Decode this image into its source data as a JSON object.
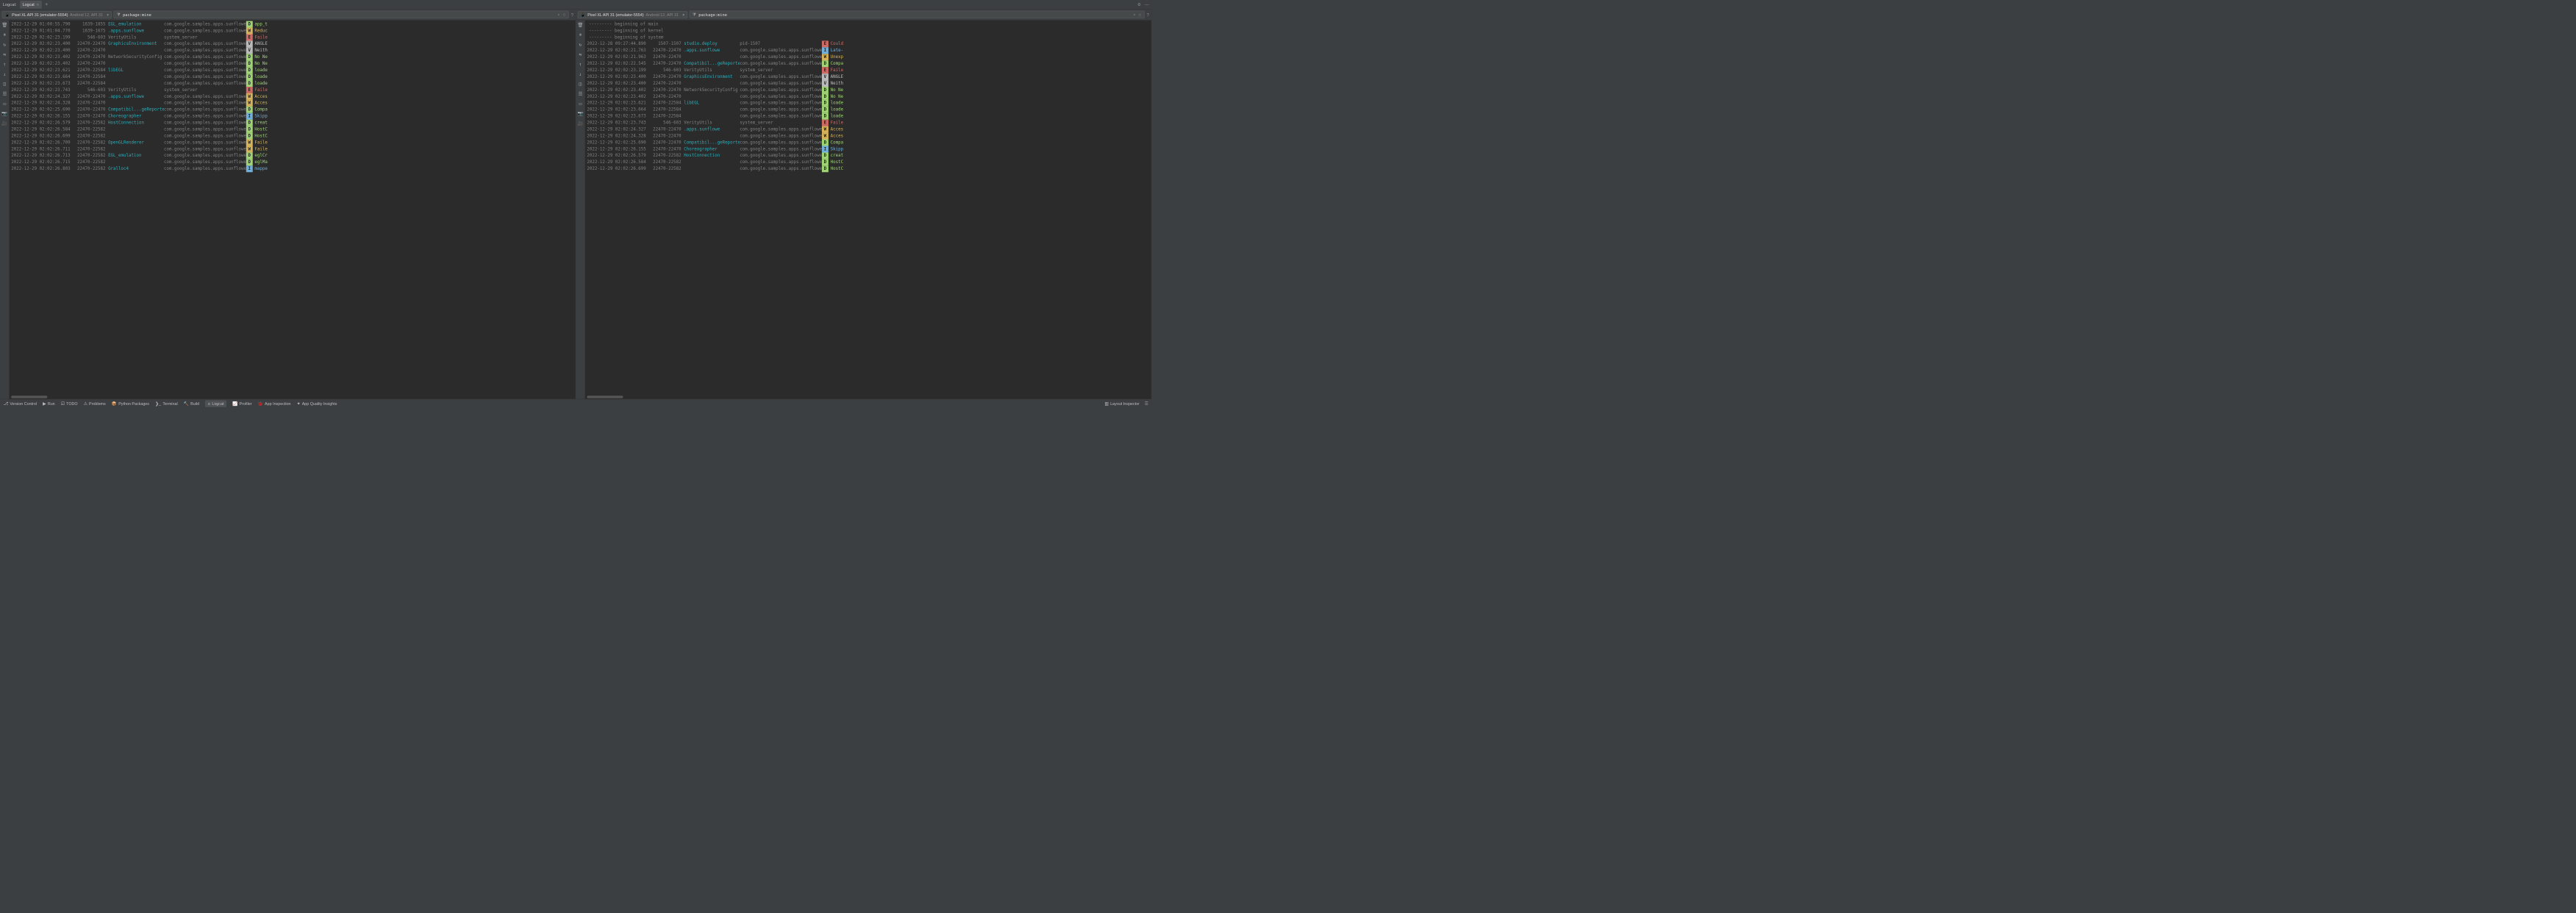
{
  "topbar": {
    "title": "Logcat:",
    "tab": "Logcat"
  },
  "device": {
    "name": "Pixel XL API 31 (emulator-5554)",
    "api": "Android 12, API 31"
  },
  "filter": {
    "text": "package:mine"
  },
  "left_logs": [
    {
      "ts": "2022-12-29 01:00:55.790",
      "pt": "1639-1855",
      "tag": "EGL_emulation",
      "tagc": "cyan",
      "pkg": "com.google.samples.apps.sunflower",
      "lvl": "D",
      "msg": "app_t"
    },
    {
      "ts": "2022-12-29 01:01:04.770",
      "pt": "1639-1675",
      "tag": ".apps.sunflowe",
      "tagc": "cyan",
      "pkg": "com.google.samples.apps.sunflower",
      "lvl": "W",
      "msg": "Reduc"
    },
    {
      "ts": "2022-12-29 02:02:23.199",
      "pt": "546-603",
      "tag": "VerityUtils",
      "tagc": "gray",
      "pkg": "system_server",
      "lvl": "E",
      "msg": "Faile"
    },
    {
      "ts": "2022-12-29 02:02:23.400",
      "pt": "22470-22470",
      "tag": "GraphicsEnvironment",
      "tagc": "cyan",
      "pkg": "com.google.samples.apps.sunflower",
      "lvl": "V",
      "msg": "ANGLE"
    },
    {
      "ts": "2022-12-29 02:02:23.400",
      "pt": "22470-22470",
      "tag": "",
      "tagc": "gray",
      "pkg": "com.google.samples.apps.sunflower",
      "lvl": "V",
      "msg": "Neith"
    },
    {
      "ts": "2022-12-29 02:02:23.402",
      "pt": "22470-22470",
      "tag": "NetworkSecurityConfig",
      "tagc": "gray",
      "pkg": "com.google.samples.apps.sunflower",
      "lvl": "D",
      "msg": "No Ne"
    },
    {
      "ts": "2022-12-29 02:02:23.402",
      "pt": "22470-22470",
      "tag": "",
      "tagc": "gray",
      "pkg": "com.google.samples.apps.sunflower",
      "lvl": "D",
      "msg": "No Ne"
    },
    {
      "ts": "2022-12-29 02:02:23.621",
      "pt": "22470-22584",
      "tag": "libEGL",
      "tagc": "cyan",
      "pkg": "com.google.samples.apps.sunflower",
      "lvl": "D",
      "msg": "loade"
    },
    {
      "ts": "2022-12-29 02:02:23.664",
      "pt": "22470-22584",
      "tag": "",
      "tagc": "gray",
      "pkg": "com.google.samples.apps.sunflower",
      "lvl": "D",
      "msg": "loade"
    },
    {
      "ts": "2022-12-29 02:02:23.673",
      "pt": "22470-22584",
      "tag": "",
      "tagc": "gray",
      "pkg": "com.google.samples.apps.sunflower",
      "lvl": "D",
      "msg": "loade"
    },
    {
      "ts": "2022-12-29 02:02:23.743",
      "pt": "546-603",
      "tag": "VerityUtils",
      "tagc": "gray",
      "pkg": "system_server",
      "lvl": "E",
      "msg": "Faile"
    },
    {
      "ts": "2022-12-29 02:02:24.327",
      "pt": "22470-22470",
      "tag": ".apps.sunflowe",
      "tagc": "cyan",
      "pkg": "com.google.samples.apps.sunflower",
      "lvl": "W",
      "msg": "Acces"
    },
    {
      "ts": "2022-12-29 02:02:24.328",
      "pt": "22470-22470",
      "tag": "",
      "tagc": "gray",
      "pkg": "com.google.samples.apps.sunflower",
      "lvl": "W",
      "msg": "Acces"
    },
    {
      "ts": "2022-12-29 02:02:25.690",
      "pt": "22470-22470",
      "tag": "Compatibil...geReporter",
      "tagc": "cyan",
      "pkg": "com.google.samples.apps.sunflower",
      "lvl": "D",
      "msg": "Compa"
    },
    {
      "ts": "2022-12-29 02:02:26.155",
      "pt": "22470-22470",
      "tag": "Choreographer",
      "tagc": "cyan",
      "pkg": "com.google.samples.apps.sunflower",
      "lvl": "I",
      "msg": "Skipp"
    },
    {
      "ts": "2022-12-29 02:02:26.579",
      "pt": "22470-22582",
      "tag": "HostConnection",
      "tagc": "cyan",
      "pkg": "com.google.samples.apps.sunflower",
      "lvl": "D",
      "msg": "creat"
    },
    {
      "ts": "2022-12-29 02:02:26.584",
      "pt": "22470-22582",
      "tag": "",
      "tagc": "gray",
      "pkg": "com.google.samples.apps.sunflower",
      "lvl": "D",
      "msg": "HostC"
    },
    {
      "ts": "2022-12-29 02:02:26.699",
      "pt": "22470-22582",
      "tag": "",
      "tagc": "gray",
      "pkg": "com.google.samples.apps.sunflower",
      "lvl": "D",
      "msg": "HostC"
    },
    {
      "ts": "2022-12-29 02:02:26.709",
      "pt": "22470-22582",
      "tag": "OpenGLRenderer",
      "tagc": "cyan",
      "pkg": "com.google.samples.apps.sunflower",
      "lvl": "W",
      "msg": "Faile"
    },
    {
      "ts": "2022-12-29 02:02:26.711",
      "pt": "22470-22582",
      "tag": "",
      "tagc": "gray",
      "pkg": "com.google.samples.apps.sunflower",
      "lvl": "W",
      "msg": "Faile"
    },
    {
      "ts": "2022-12-29 02:02:26.713",
      "pt": "22470-22582",
      "tag": "EGL_emulation",
      "tagc": "cyan",
      "pkg": "com.google.samples.apps.sunflower",
      "lvl": "D",
      "msg": "eglCr"
    },
    {
      "ts": "2022-12-29 02:02:26.715",
      "pt": "22470-22582",
      "tag": "",
      "tagc": "gray",
      "pkg": "com.google.samples.apps.sunflower",
      "lvl": "D",
      "msg": "eglMa"
    },
    {
      "ts": "2022-12-29 02:02:26.803",
      "pt": "22470-22582",
      "tag": "Gralloc4",
      "tagc": "cyan",
      "pkg": "com.google.samples.apps.sunflower",
      "lvl": "I",
      "msg": "mappe"
    }
  ],
  "right_prelude": [
    "--------- beginning of main",
    "--------- beginning of kernel",
    "--------- beginning of system"
  ],
  "right_logs": [
    {
      "ts": "2022-12-28 09:27:44.890",
      "pt": "1507-1507",
      "tag": "studio.deploy",
      "tagc": "cyan",
      "pkg": "pid-1507",
      "lvl": "E",
      "msg": "Could"
    },
    {
      "ts": "2022-12-29 02:02:21.763",
      "pt": "22470-22470",
      "tag": ".apps.sunflowe",
      "tagc": "cyan",
      "pkg": "com.google.samples.apps.sunflower",
      "lvl": "I",
      "msg": "Late-"
    },
    {
      "ts": "2022-12-29 02:02:21.963",
      "pt": "22470-22470",
      "tag": "",
      "tagc": "gray",
      "pkg": "com.google.samples.apps.sunflower",
      "lvl": "W",
      "msg": "Unexp"
    },
    {
      "ts": "2022-12-29 02:02:22.545",
      "pt": "22470-22470",
      "tag": "Compatibil...geReporter",
      "tagc": "cyan",
      "pkg": "com.google.samples.apps.sunflower",
      "lvl": "D",
      "msg": "Compa"
    },
    {
      "ts": "2022-12-29 02:02:23.199",
      "pt": "546-603",
      "tag": "VerityUtils",
      "tagc": "gray",
      "pkg": "system_server",
      "lvl": "E",
      "msg": "Faile"
    },
    {
      "ts": "2022-12-29 02:02:23.400",
      "pt": "22470-22470",
      "tag": "GraphicsEnvironment",
      "tagc": "cyan",
      "pkg": "com.google.samples.apps.sunflower",
      "lvl": "V",
      "msg": "ANGLE"
    },
    {
      "ts": "2022-12-29 02:02:23.400",
      "pt": "22470-22470",
      "tag": "",
      "tagc": "gray",
      "pkg": "com.google.samples.apps.sunflower",
      "lvl": "V",
      "msg": "Neith"
    },
    {
      "ts": "2022-12-29 02:02:23.402",
      "pt": "22470-22470",
      "tag": "NetworkSecurityConfig",
      "tagc": "gray",
      "pkg": "com.google.samples.apps.sunflower",
      "lvl": "D",
      "msg": "No Ne"
    },
    {
      "ts": "2022-12-29 02:02:23.402",
      "pt": "22470-22470",
      "tag": "",
      "tagc": "gray",
      "pkg": "com.google.samples.apps.sunflower",
      "lvl": "D",
      "msg": "No Ne"
    },
    {
      "ts": "2022-12-29 02:02:23.621",
      "pt": "22470-22584",
      "tag": "libEGL",
      "tagc": "cyan",
      "pkg": "com.google.samples.apps.sunflower",
      "lvl": "D",
      "msg": "loade"
    },
    {
      "ts": "2022-12-29 02:02:23.664",
      "pt": "22470-22584",
      "tag": "",
      "tagc": "gray",
      "pkg": "com.google.samples.apps.sunflower",
      "lvl": "D",
      "msg": "loade"
    },
    {
      "ts": "2022-12-29 02:02:23.673",
      "pt": "22470-22584",
      "tag": "",
      "tagc": "gray",
      "pkg": "com.google.samples.apps.sunflower",
      "lvl": "D",
      "msg": "loade"
    },
    {
      "ts": "2022-12-29 02:02:23.743",
      "pt": "546-603",
      "tag": "VerityUtils",
      "tagc": "gray",
      "pkg": "system_server",
      "lvl": "E",
      "msg": "Faile"
    },
    {
      "ts": "2022-12-29 02:02:24.327",
      "pt": "22470-22470",
      "tag": ".apps.sunflowe",
      "tagc": "cyan",
      "pkg": "com.google.samples.apps.sunflower",
      "lvl": "W",
      "msg": "Acces"
    },
    {
      "ts": "2022-12-29 02:02:24.328",
      "pt": "22470-22470",
      "tag": "",
      "tagc": "gray",
      "pkg": "com.google.samples.apps.sunflower",
      "lvl": "W",
      "msg": "Acces"
    },
    {
      "ts": "2022-12-29 02:02:25.690",
      "pt": "22470-22470",
      "tag": "Compatibil...geReporter",
      "tagc": "cyan",
      "pkg": "com.google.samples.apps.sunflower",
      "lvl": "D",
      "msg": "Compa"
    },
    {
      "ts": "2022-12-29 02:02:26.155",
      "pt": "22470-22470",
      "tag": "Choreographer",
      "tagc": "cyan",
      "pkg": "com.google.samples.apps.sunflower",
      "lvl": "I",
      "msg": "Skipp"
    },
    {
      "ts": "2022-12-29 02:02:26.579",
      "pt": "22470-22582",
      "tag": "HostConnection",
      "tagc": "cyan",
      "pkg": "com.google.samples.apps.sunflower",
      "lvl": "D",
      "msg": "creat"
    },
    {
      "ts": "2022-12-29 02:02:26.584",
      "pt": "22470-22582",
      "tag": "",
      "tagc": "gray",
      "pkg": "com.google.samples.apps.sunflower",
      "lvl": "D",
      "msg": "HostC"
    },
    {
      "ts": "2022-12-29 02:02:26.699",
      "pt": "22470-22582",
      "tag": "",
      "tagc": "gray",
      "pkg": "com.google.samples.apps.sunflower",
      "lvl": "D",
      "msg": "HostC"
    }
  ],
  "side_tools": [
    "trash",
    "pause",
    "restart",
    "wrap",
    "up",
    "down",
    "split",
    "settings",
    "dock",
    "camera",
    "video"
  ],
  "bottom": {
    "version_control": "Version Control",
    "run": "Run",
    "todo": "TODO",
    "problems": "Problems",
    "python_packages": "Python Packages",
    "terminal": "Terminal",
    "build": "Build",
    "logcat": "Logcat",
    "profiler": "Profiler",
    "app_inspection": "App Inspection",
    "app_quality": "App Quality Insights",
    "layout_inspector": "Layout Inspector"
  }
}
